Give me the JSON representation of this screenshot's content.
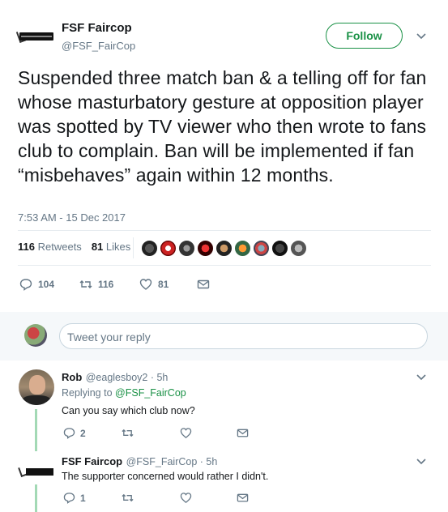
{
  "tweet": {
    "author_name": "FSF Faircop",
    "author_handle": "@FSF_FairCop",
    "follow_label": "Follow",
    "text": "Suspended three match ban & a telling off for fan whose masturbatory gesture at opposition player was spotted by TV viewer who then wrote to fans club to complain.  Ban will be implemented if fan “misbehaves” again within 12 months.",
    "timestamp": "7:53 AM - 15 Dec 2017",
    "retweets_count": "116",
    "retweets_label": "Retweets",
    "likes_count": "81",
    "likes_label": "Likes",
    "actions": {
      "reply_count": "104",
      "retweet_count": "116",
      "like_count": "81"
    }
  },
  "compose": {
    "placeholder": "Tweet your reply"
  },
  "replies": [
    {
      "name": "Rob",
      "handle_time": "@eaglesboy2 · 5h",
      "replying_to_prefix": "Replying to",
      "replying_to_handle": "@FSF_FairCop",
      "text": "Can you say which club now?",
      "reply_count": "2"
    },
    {
      "name": "FSF Faircop",
      "handle_time": "@FSF_FairCop · 5h",
      "text": "The supporter concerned would rather I didn't.",
      "reply_count": "1"
    }
  ],
  "colors": {
    "accent": "#1a9146",
    "muted": "#657786",
    "thread_line": "#a3d9b5",
    "band": "#f5f8fa"
  },
  "icons": [
    "chevron-down-icon",
    "reply-icon",
    "retweet-icon",
    "heart-icon",
    "message-icon"
  ]
}
